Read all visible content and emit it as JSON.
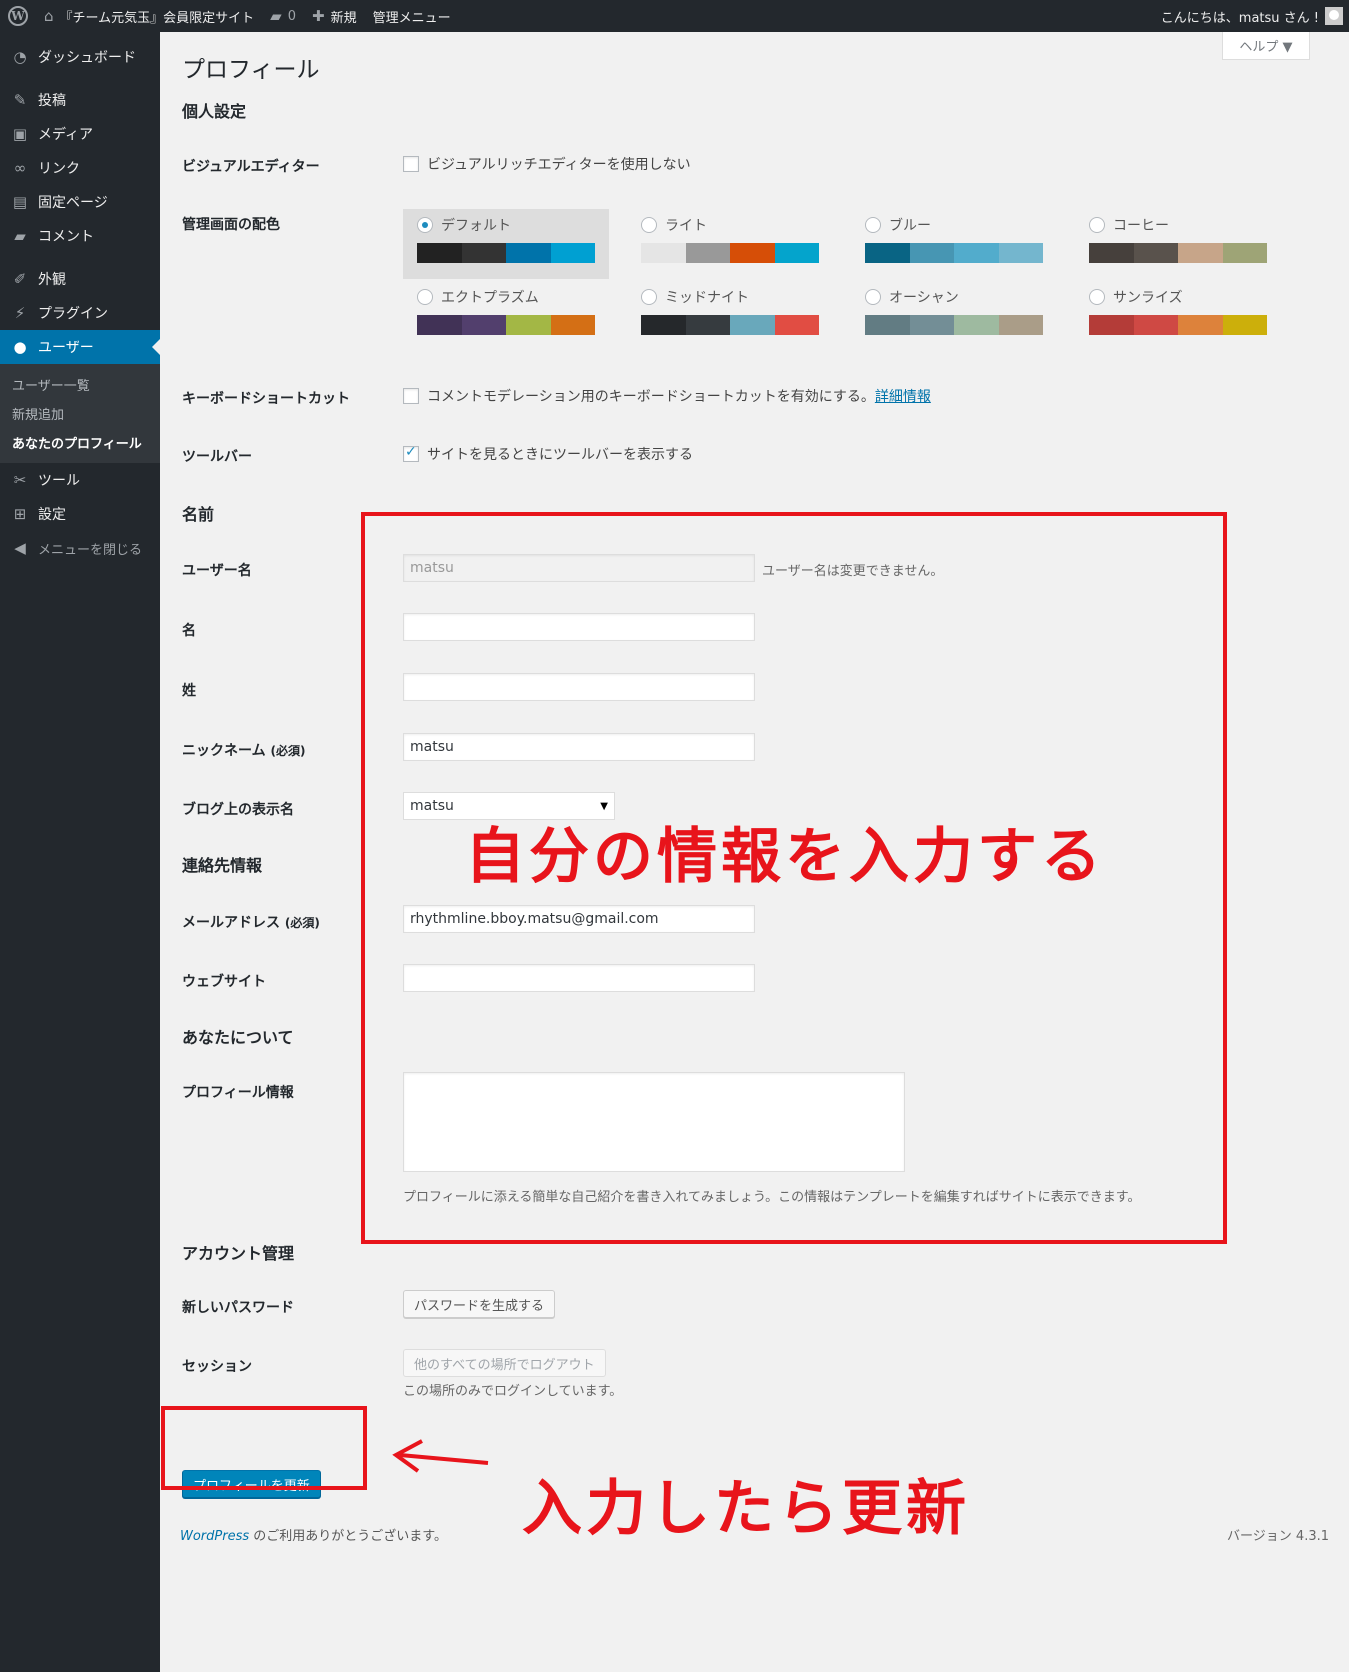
{
  "admin_bar": {
    "site_name": "『チーム元気玉』会員限定サイト",
    "comments_count": "0",
    "new_label": "新規",
    "admin_menu_label": "管理メニュー",
    "greeting": "こんにちは、matsu さん !"
  },
  "sidebar": {
    "items": [
      {
        "icon": "dashboard-icon",
        "label": "ダッシュボード"
      },
      {
        "icon": "pin-icon",
        "label": "投稿"
      },
      {
        "icon": "media-icon",
        "label": "メディア"
      },
      {
        "icon": "link-icon",
        "label": "リンク"
      },
      {
        "icon": "page-icon",
        "label": "固定ページ"
      },
      {
        "icon": "comment-icon",
        "label": "コメント"
      },
      {
        "icon": "appearance-icon",
        "label": "外観"
      },
      {
        "icon": "plugin-icon",
        "label": "プラグイン"
      },
      {
        "icon": "user-icon",
        "label": "ユーザー"
      },
      {
        "icon": "tools-icon",
        "label": "ツール"
      },
      {
        "icon": "settings-icon",
        "label": "設定"
      }
    ],
    "submenu": [
      "ユーザー一覧",
      "新規追加",
      "あなたのプロフィール"
    ],
    "collapse_label": "メニューを閉じる"
  },
  "help_label": "ヘルプ ▼",
  "page_title": "プロフィール",
  "personal": {
    "heading": "個人設定",
    "visual_editor_label": "ビジュアルエディター",
    "visual_editor_text": "ビジュアルリッチエディターを使用しない",
    "color_scheme_label": "管理画面の配色",
    "schemes": [
      {
        "name": "デフォルト",
        "selected": true,
        "colors": [
          "#222222",
          "#333333",
          "#0073aa",
          "#00a0d2"
        ]
      },
      {
        "name": "ライト",
        "selected": false,
        "colors": [
          "#e5e5e5",
          "#999999",
          "#d64e07",
          "#04a4cc"
        ]
      },
      {
        "name": "ブルー",
        "selected": false,
        "colors": [
          "#096484",
          "#4796b3",
          "#52accc",
          "#74b6ce"
        ]
      },
      {
        "name": "コーヒー",
        "selected": false,
        "colors": [
          "#46403c",
          "#59524c",
          "#c7a589",
          "#9ea476"
        ]
      },
      {
        "name": "エクトプラズム",
        "selected": false,
        "colors": [
          "#413256",
          "#523f6d",
          "#a3b745",
          "#d46f15"
        ]
      },
      {
        "name": "ミッドナイト",
        "selected": false,
        "colors": [
          "#25282b",
          "#363b3f",
          "#69a8bb",
          "#e14d43"
        ]
      },
      {
        "name": "オーシャン",
        "selected": false,
        "colors": [
          "#627c83",
          "#738e96",
          "#9ebaa0",
          "#aa9d88"
        ]
      },
      {
        "name": "サンライズ",
        "selected": false,
        "colors": [
          "#b43c38",
          "#cf4944",
          "#dd823b",
          "#ccaf0b"
        ]
      }
    ],
    "keyboard_label": "キーボードショートカット",
    "keyboard_text": "コメントモデレーション用のキーボードショートカットを有効にする。",
    "keyboard_link": "詳細情報",
    "toolbar_label": "ツールバー",
    "toolbar_text": "サイトを見るときにツールバーを表示する"
  },
  "name": {
    "heading": "名前",
    "username_label": "ユーザー名",
    "username_value": "matsu",
    "username_note": "ユーザー名は変更できません。",
    "first_label": "名",
    "first_value": "",
    "last_label": "姓",
    "last_value": "",
    "nickname_label": "ニックネーム",
    "required": "(必須)",
    "nickname_value": "matsu",
    "display_label": "ブログ上の表示名",
    "display_value": "matsu"
  },
  "contact": {
    "heading": "連絡先情報",
    "email_label": "メールアドレス",
    "email_value": "rhythmline.bboy.matsu@gmail.com",
    "website_label": "ウェブサイト",
    "website_value": ""
  },
  "about": {
    "heading": "あなたについて",
    "bio_label": "プロフィール情報",
    "bio_desc": "プロフィールに添える簡単な自己紹介を書き入れてみましょう。この情報はテンプレートを編集すればサイトに表示できます。"
  },
  "account": {
    "heading": "アカウント管理",
    "password_label": "新しいパスワード",
    "password_button": "パスワードを生成する",
    "sessions_label": "セッション",
    "sessions_button": "他のすべての場所でログアウト",
    "sessions_note": "この場所のみでログインしています。"
  },
  "submit_label": "プロフィールを更新",
  "annotations": {
    "box_text": "自分の情報を入力する",
    "update_text": "入力したら更新"
  },
  "footer": {
    "wordpress": "WordPress",
    "thanks": " のご利用ありがとうございます。",
    "version": "バージョン 4.3.1"
  },
  "colors": {
    "accent": "#0073aa",
    "annotation_red": "#e8141b"
  }
}
